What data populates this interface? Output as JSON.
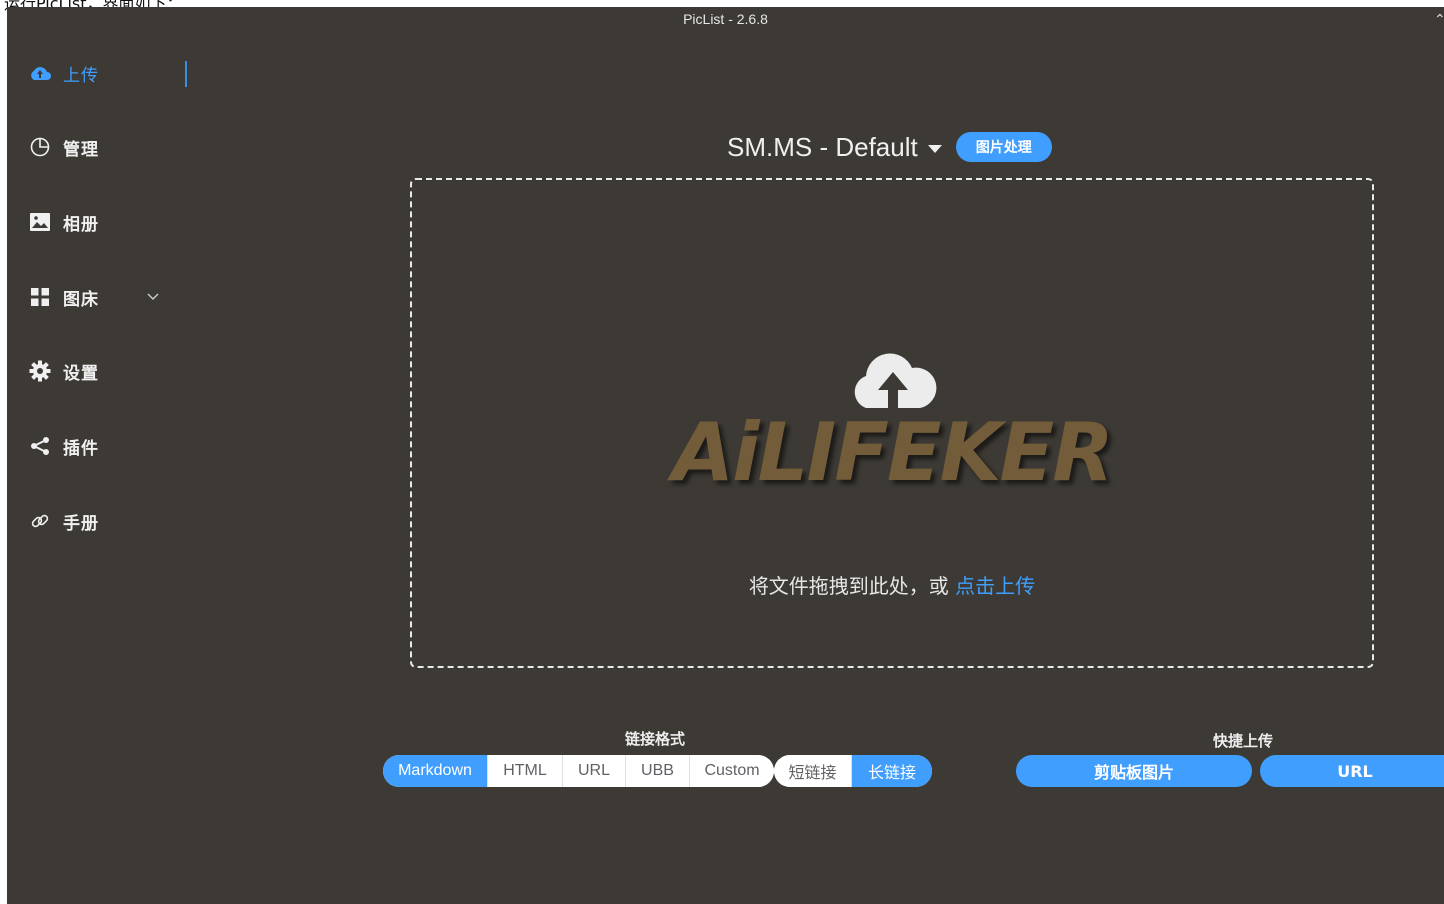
{
  "caption": "运行PicList，界面如下：",
  "window": {
    "title": "PicList - 2.6.8"
  },
  "sidebar": {
    "items": [
      {
        "label": "上传",
        "icon": "cloud-upload-icon",
        "active": true
      },
      {
        "label": "管理",
        "icon": "pie-chart-icon"
      },
      {
        "label": "相册",
        "icon": "picture-icon"
      },
      {
        "label": "图床",
        "icon": "grid-icon",
        "expandable": true
      },
      {
        "label": "设置",
        "icon": "gear-icon"
      },
      {
        "label": "插件",
        "icon": "share-icon"
      },
      {
        "label": "手册",
        "icon": "link-icon"
      }
    ]
  },
  "uploader": {
    "pic_bed": "SM.MS - Default",
    "image_process_label": "图片处理",
    "watermark": "AiLIFEKER",
    "drop_text": "将文件拖拽到此处，或 ",
    "drop_link": "点击上传"
  },
  "link_format": {
    "title": "链接格式",
    "options": [
      "Markdown",
      "HTML",
      "URL",
      "UBB",
      "Custom"
    ],
    "selected": "Markdown",
    "length_options": [
      "短链接",
      "长链接"
    ],
    "length_selected": "长链接"
  },
  "quick_upload": {
    "title": "快捷上传",
    "clipboard_label": "剪贴板图片",
    "url_label": "URL"
  },
  "colors": {
    "accent": "#409eff",
    "background": "#3d3a35",
    "watermark": "#725c3a"
  }
}
